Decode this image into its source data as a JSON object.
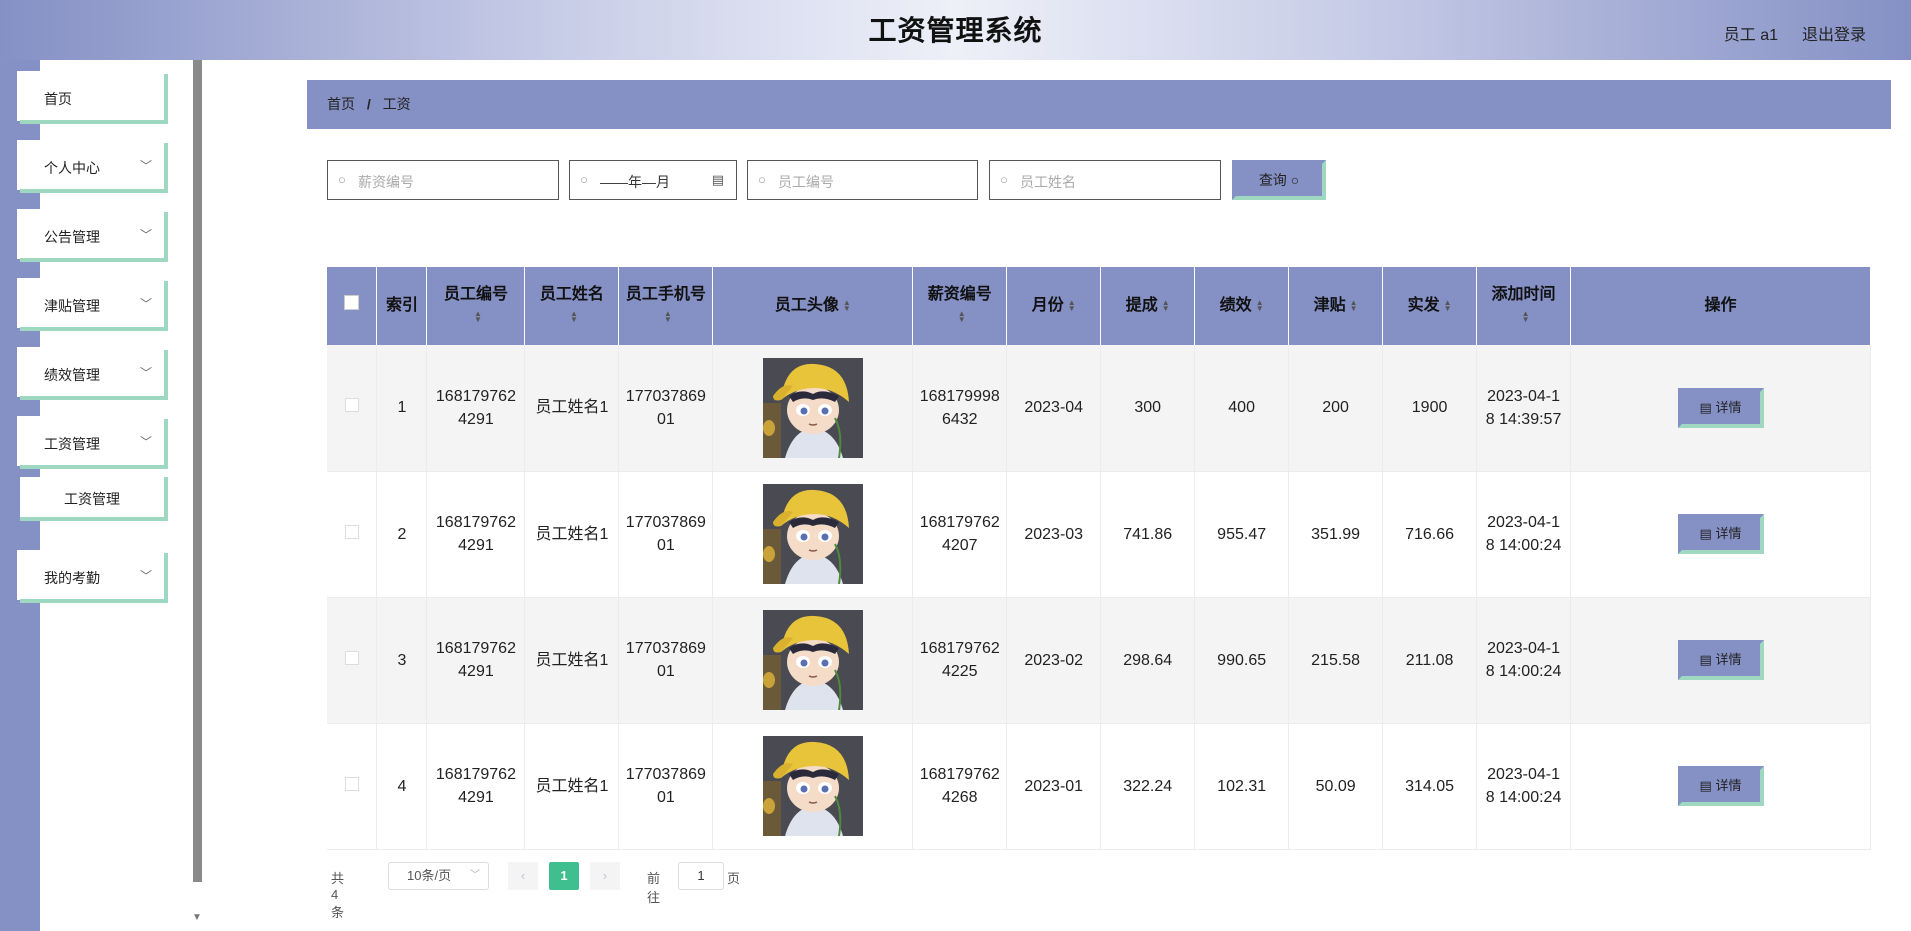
{
  "header": {
    "title": "工资管理系统",
    "user": "员工 a1",
    "logout": "退出登录"
  },
  "sidebar": {
    "items": [
      {
        "label": "首页",
        "has_children": false
      },
      {
        "label": "个人中心",
        "has_children": true
      },
      {
        "label": "公告管理",
        "has_children": true
      },
      {
        "label": "津贴管理",
        "has_children": true
      },
      {
        "label": "绩效管理",
        "has_children": true
      },
      {
        "label": "工资管理",
        "has_children": true,
        "expanded": true
      },
      {
        "label": "我的考勤",
        "has_children": true
      }
    ],
    "sub_item": "工资管理"
  },
  "breadcrumb": {
    "home": "首页",
    "separator": "/",
    "current": "工资"
  },
  "search": {
    "salary_no_placeholder": "薪资编号",
    "month_value": "——年—月",
    "emp_no_placeholder": "员工编号",
    "emp_name_placeholder": "员工姓名",
    "query_label": "查询"
  },
  "table": {
    "headers": [
      "索引",
      "员工编号",
      "员工姓名",
      "员工手机号",
      "员工头像",
      "薪资编号",
      "月份",
      "提成",
      "绩效",
      "津贴",
      "实发",
      "添加时间",
      "操作"
    ],
    "rows": [
      {
        "index": "1",
        "emp_no": "1681797624291",
        "emp_name": "员工姓名1",
        "phone": "17703786901",
        "salary_no": "1681799986432",
        "month": "2023-04",
        "commission": "300",
        "performance": "400",
        "allowance": "200",
        "actual": "1900",
        "added": "2023-04-18 14:39:57",
        "action": "详情"
      },
      {
        "index": "2",
        "emp_no": "1681797624291",
        "emp_name": "员工姓名1",
        "phone": "17703786901",
        "salary_no": "1681797624207",
        "month": "2023-03",
        "commission": "741.86",
        "performance": "955.47",
        "allowance": "351.99",
        "actual": "716.66",
        "added": "2023-04-18 14:00:24",
        "action": "详情"
      },
      {
        "index": "3",
        "emp_no": "1681797624291",
        "emp_name": "员工姓名1",
        "phone": "17703786901",
        "salary_no": "1681797624225",
        "month": "2023-02",
        "commission": "298.64",
        "performance": "990.65",
        "allowance": "215.58",
        "actual": "211.08",
        "added": "2023-04-18 14:00:24",
        "action": "详情"
      },
      {
        "index": "4",
        "emp_no": "1681797624291",
        "emp_name": "员工姓名1",
        "phone": "17703786901",
        "salary_no": "1681797624268",
        "month": "2023-01",
        "commission": "322.24",
        "performance": "102.31",
        "allowance": "50.09",
        "actual": "314.05",
        "added": "2023-04-18 14:00:24",
        "action": "详情"
      }
    ]
  },
  "pagination": {
    "total": "共 4 条",
    "page_size": "10条/页",
    "current_page": "1",
    "goto_label": "前往",
    "goto_value": "1",
    "page_suffix": "页"
  },
  "colors": {
    "accent": "#8590c5",
    "border_accent": "#9fd8c1",
    "pager_active": "#3fbf8f"
  },
  "icons": {
    "search": "search-icon",
    "calendar": "calendar-icon",
    "chevron": "chevron-down-icon",
    "detail": "document-icon",
    "sort": "sort-icon"
  }
}
